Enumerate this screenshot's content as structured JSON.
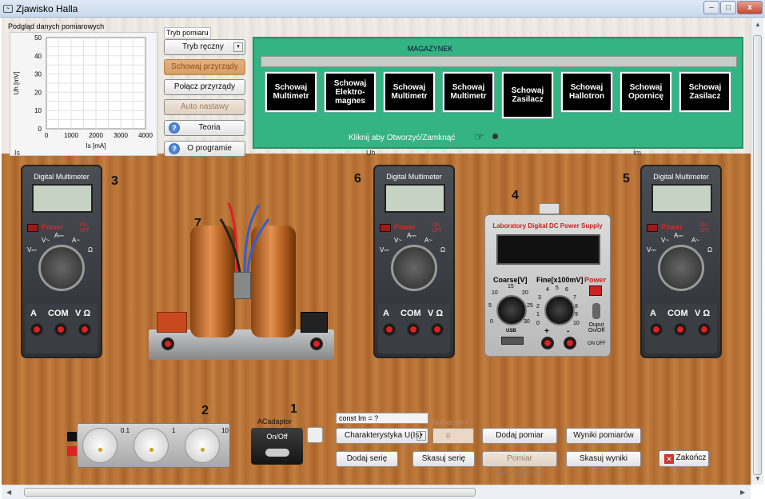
{
  "window": {
    "title": "Zjawisko Halla",
    "min": "–",
    "max": "□",
    "close": "x"
  },
  "graph": {
    "title": "Podgląd danych pomiarowych",
    "chart_data": {
      "type": "line",
      "series": [],
      "xlabel": "Is [mA]",
      "ylabel": "Uh [mV]",
      "xlim": [
        0,
        4000
      ],
      "ylim": [
        0,
        50
      ],
      "xticks": [
        "0",
        "1000",
        "2000",
        "3000",
        "4000"
      ],
      "yticks": [
        "0",
        "10",
        "20",
        "30",
        "40",
        "50"
      ],
      "grid": true
    }
  },
  "controls": {
    "mode_label": "Tryb pomiaru",
    "mode_select": "Tryb ręczny",
    "hide_devices": "Schowaj przyrządy",
    "connect_devices": "Połącz przyrządy",
    "auto_setup": "Auto nastawy",
    "theory": "Teoria",
    "about": "O programie"
  },
  "magazine": {
    "title": "MAGAZYNEK",
    "hint": "Kliknij aby Otworzyć/Zamknąć",
    "tiles": [
      "Schowaj Multimetr",
      "Schowaj Elektro-magnes",
      "Schowaj Multimetr",
      "Schowaj Multimetr",
      "Schowaj Zasilacz",
      "Schowaj Hallotron",
      "Schowaj Opornicę",
      "Schowaj Zasilacz"
    ]
  },
  "labels": {
    "is": "Is",
    "uh": "Uh",
    "im": "Im",
    "n1": "1",
    "n2": "2",
    "n3": "3",
    "n4": "4",
    "n5": "5",
    "n6": "6",
    "n7": "7"
  },
  "meter": {
    "title": "Digital Multimeter",
    "power": "Power",
    "on": "ON",
    "off": "OFF",
    "r_vdc": "V⎓",
    "r_adc": "A⎓",
    "r_vac": "V~",
    "r_aac": "A~",
    "r_ohm": "Ω",
    "j_a": "A",
    "j_com": "COM",
    "j_vo": "V Ω"
  },
  "psu": {
    "title": "Laboratory Digital DC Power Supply",
    "coarse": "Coarse[V]",
    "fine": "Fine[x100mV]",
    "power": "Power",
    "output": "Ouput On/Off",
    "usb": "USB",
    "plus": "+",
    "minus": "-",
    "on_off": "ON OFF",
    "coarse_ticks": [
      "0",
      "5",
      "10",
      "15",
      "20",
      "25",
      "30"
    ],
    "fine_ticks": [
      "0",
      "1",
      "2",
      "3",
      "4",
      "5",
      "6",
      "7",
      "8",
      "9",
      "10"
    ]
  },
  "resistor": {
    "k1": "0.1",
    "k2": "1",
    "k3": "10"
  },
  "adaptor": {
    "label": "ACadaptor",
    "switch": "On/Off"
  },
  "bottom": {
    "const_field": "const Im = ?",
    "series_label": "Numer serii",
    "series_value": "0",
    "characteristic": "Charakterystyka U(Is)",
    "add_measurement": "Dodaj pomiar",
    "results": "Wyniki pomiarów",
    "add_series": "Dodaj serię",
    "delete_series": "Skasuj serię",
    "auto_measurement": "Pomiar automatyczny",
    "delete_results": "Skasuj wyniki",
    "finish": "Zakończ"
  }
}
